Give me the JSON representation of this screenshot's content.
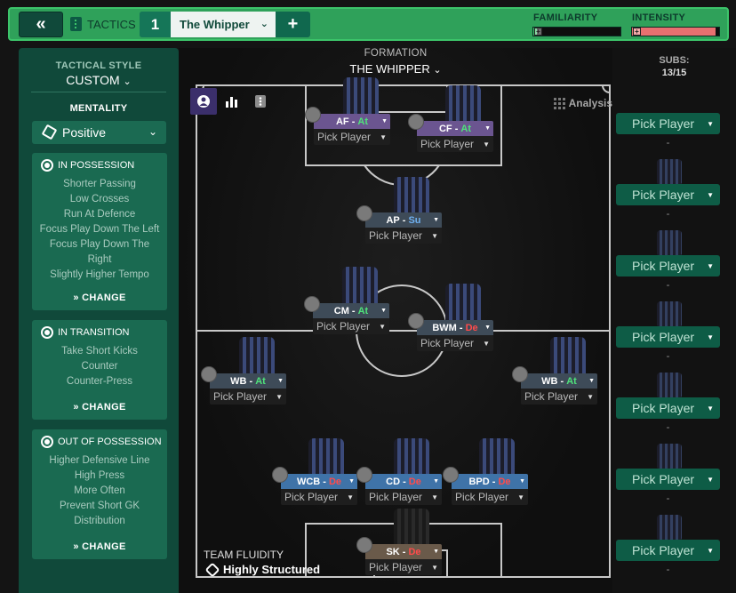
{
  "topbar": {
    "tactics_label": "TACTICS",
    "tactic_number": "1",
    "tactic_name": "The Whipper",
    "add_label": "+",
    "familiarity_label": "FAMILIARITY",
    "familiarity_level": 0.04,
    "intensity_label": "INTENSITY",
    "intensity_level": 0.96
  },
  "sidebar": {
    "tactical_style_title": "TACTICAL STYLE",
    "tactical_style_value": "CUSTOM",
    "mentality_title": "MENTALITY",
    "mentality_value": "Positive",
    "in_possession": {
      "title": "IN POSSESSION",
      "items": [
        "Shorter Passing",
        "Low Crosses",
        "Run At Defence",
        "Focus Play Down The Left",
        "Focus Play Down The Right",
        "Slightly Higher Tempo"
      ],
      "change": "CHANGE"
    },
    "in_transition": {
      "title": "IN TRANSITION",
      "items": [
        "Take Short Kicks",
        "Counter",
        "Counter-Press"
      ],
      "change": "CHANGE"
    },
    "out_of_possession": {
      "title": "OUT OF POSSESSION",
      "items": [
        "Higher Defensive Line",
        "High Press",
        "More Often",
        "Prevent Short GK",
        "Distribution"
      ],
      "change": "CHANGE"
    }
  },
  "pitch": {
    "formation_title": "FORMATION",
    "formation_name": "THE WHIPPER",
    "analysis_label": "Analysis",
    "team_fluidity_label": "TEAM FLUIDITY",
    "team_fluidity_value": "Highly Structured",
    "players": [
      {
        "role": "AF",
        "duty": "At",
        "pick": "Pick Player"
      },
      {
        "role": "CF",
        "duty": "At",
        "pick": "Pick Player"
      },
      {
        "role": "AP",
        "duty": "Su",
        "pick": "Pick Player"
      },
      {
        "role": "CM",
        "duty": "At",
        "pick": "Pick Player"
      },
      {
        "role": "BWM",
        "duty": "De",
        "pick": "Pick Player"
      },
      {
        "role": "WB",
        "duty": "At",
        "pick": "Pick Player"
      },
      {
        "role": "WB",
        "duty": "At",
        "pick": "Pick Player"
      },
      {
        "role": "WCB",
        "duty": "De",
        "pick": "Pick Player"
      },
      {
        "role": "CD",
        "duty": "De",
        "pick": "Pick Player"
      },
      {
        "role": "BPD",
        "duty": "De",
        "pick": "Pick Player"
      },
      {
        "role": "SK",
        "duty": "De",
        "pick": "Pick Player"
      }
    ]
  },
  "subs": {
    "title": "SUBS:",
    "count": "13/15",
    "pick_label": "Pick Player",
    "dash": "-"
  },
  "colors": {
    "accent_green": "#2fa15a",
    "panel_green": "#10493a",
    "attack": "#4fe27b",
    "support": "#6fb0f0",
    "defend": "#ff4b4b"
  }
}
